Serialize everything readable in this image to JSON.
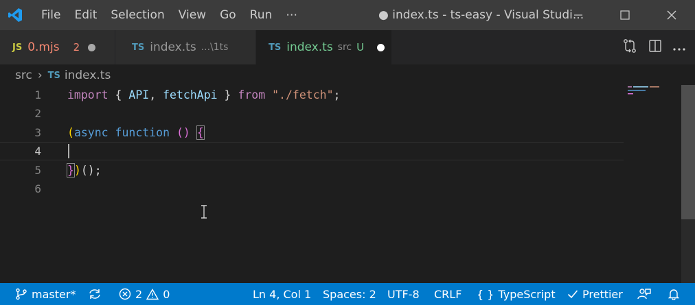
{
  "titlebar": {
    "menu": [
      "File",
      "Edit",
      "Selection",
      "View",
      "Go",
      "Run",
      "⋯"
    ],
    "title": "● index.ts - ts-easy - Visual Studi..."
  },
  "tabs": [
    {
      "type": "JS",
      "name": "0.mjs",
      "badge": "2"
    },
    {
      "type": "TS",
      "name": "index.ts",
      "desc": "...\\1ts"
    },
    {
      "type": "TS",
      "name": "index.ts",
      "desc": "src",
      "badge": "U"
    }
  ],
  "breadcrumb": {
    "folder": "src",
    "sep": "›",
    "ftype": "TS",
    "file": "index.ts"
  },
  "editor": {
    "line_numbers": [
      "1",
      "2",
      "3",
      "4",
      "5",
      "6"
    ],
    "lines": {
      "l1": {
        "import": "import",
        "ob": "{ ",
        "api": "API",
        "comma": ", ",
        "fetch": "fetchApi",
        "cb": " }",
        "from": "from",
        "str": "\"./fetch\"",
        "semi": ";"
      },
      "l3": {
        "lp": "(",
        "async": "async",
        "function": "function",
        "parens": "()",
        "brace": "{"
      },
      "l5": {
        "brace": "}",
        "rp": ")",
        "call": "();"
      }
    }
  },
  "statusbar": {
    "branch": "master*",
    "errors": "2",
    "warnings": "0",
    "position": "Ln 4, Col 1",
    "spaces": "Spaces: 2",
    "encoding": "UTF-8",
    "eol": "CRLF",
    "language_icon": "{ }",
    "language": "TypeScript",
    "prettier": "Prettier"
  },
  "colors": {
    "titlebar": "#3c3c3c",
    "statusbar": "#007acc",
    "editor_bg": "#1e1e1e",
    "tab_modified": "#f48771",
    "tab_untracked": "#73c991"
  },
  "icons": [
    "vscode-logo-icon",
    "minimize-icon",
    "maximize-icon",
    "close-icon",
    "source-control-compare-icon",
    "split-editor-icon",
    "more-icon",
    "branch-icon",
    "sync-icon",
    "error-icon",
    "warning-icon",
    "check-icon",
    "feedback-icon",
    "bell-icon"
  ]
}
